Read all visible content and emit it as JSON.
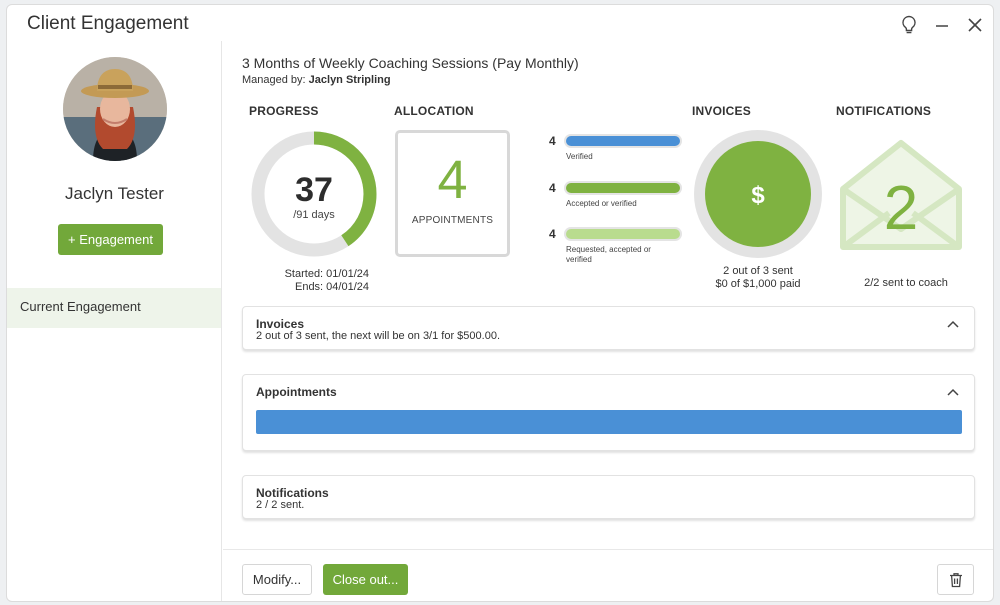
{
  "window": {
    "title": "Client Engagement"
  },
  "sidebar": {
    "client_name": "Jaclyn Tester",
    "engagement_button": "+ Engagement",
    "nav_item": "Current Engagement"
  },
  "plan": {
    "title": "3 Months of Weekly Coaching Sessions (Pay Monthly)",
    "managed_prefix": "Managed by: ",
    "managed_by": "Jaclyn Stripling"
  },
  "progress": {
    "heading": "PROGRESS",
    "days_done": "37",
    "days_total_label": "/91 days",
    "fraction": 0.4066,
    "started": "Started: 01/01/24",
    "ends": "Ends: 04/01/24"
  },
  "allocation": {
    "heading": "ALLOCATION",
    "count": "4",
    "label": "APPOINTMENTS",
    "bars": [
      {
        "count": "4",
        "caption": "Verified",
        "fraction": 1.0,
        "color": "#4a90d6"
      },
      {
        "count": "4",
        "caption": "Accepted or verified",
        "fraction": 1.0,
        "color": "#7fb241"
      },
      {
        "count": "4",
        "caption": "Requested, accepted or verified",
        "fraction": 1.0,
        "color": "#b9dc8e"
      }
    ]
  },
  "invoices": {
    "heading": "INVOICES",
    "icon": "dollar-icon",
    "sent_text": "2 out of 3 sent",
    "paid_text": "$0 of $1,000 paid"
  },
  "notifications": {
    "heading": "NOTIFICATIONS",
    "icon": "envelope-icon",
    "count": "2",
    "text": "2/2 sent to coach"
  },
  "panels": {
    "invoices": {
      "title": "Invoices",
      "subtitle": "2 out of 3 sent, the next will be on 3/1 for $500.00."
    },
    "appointments": {
      "title": "Appointments"
    },
    "notifications": {
      "title": "Notifications",
      "subtitle": "2 / 2 sent."
    }
  },
  "footer": {
    "modify_label": "Modify...",
    "close_out_label": "Close out..."
  },
  "colors": {
    "green": "#72a83a",
    "green_light": "#7fb241",
    "blue": "#4a90d6"
  }
}
